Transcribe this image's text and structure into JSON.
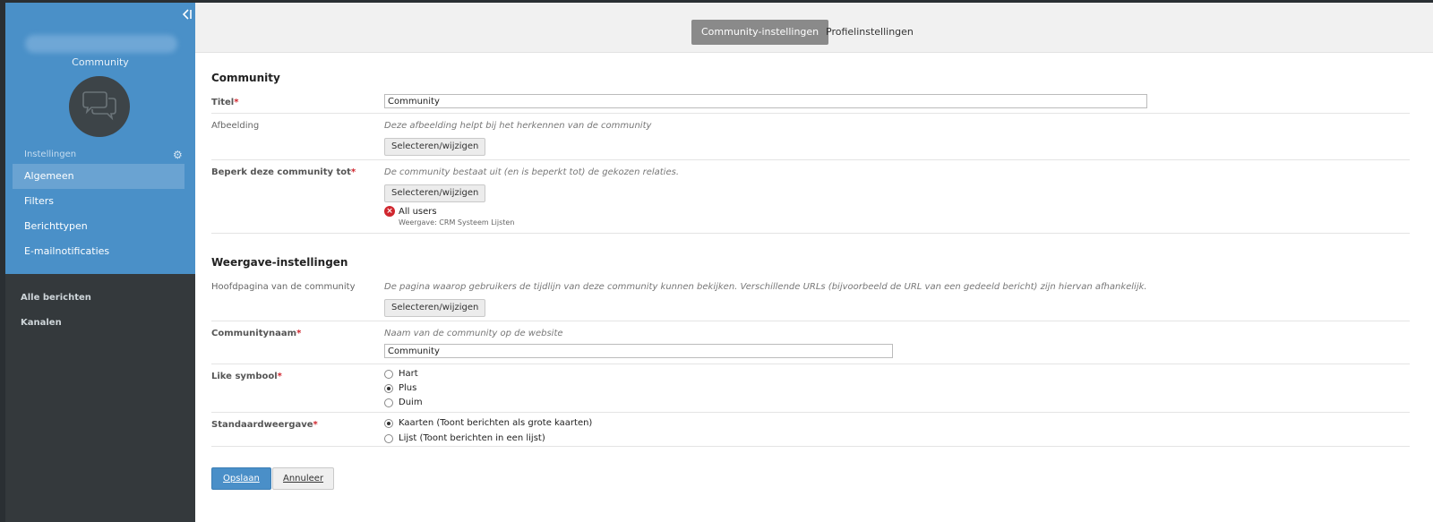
{
  "sidebar": {
    "community_label": "Community",
    "settings_heading": "Instellingen",
    "items": [
      {
        "label": "Algemeen"
      },
      {
        "label": "Filters"
      },
      {
        "label": "Berichttypen"
      },
      {
        "label": "E-mailnotificaties"
      }
    ],
    "bottom_items": [
      {
        "label": "Alle berichten"
      },
      {
        "label": "Kanalen"
      }
    ]
  },
  "tabs": [
    {
      "label": "Community-instellingen"
    },
    {
      "label": "Profielinstellingen"
    }
  ],
  "community_section": {
    "heading": "Community",
    "title_label": "Titel",
    "title_value": "Community",
    "image_label": "Afbeelding",
    "image_hint": "Deze afbeelding helpt bij het herkennen van de community",
    "image_button": "Selecteren/wijzigen",
    "restrict_label": "Beperk deze community tot",
    "restrict_hint": "De community bestaat uit (en is beperkt tot) de gekozen relaties.",
    "restrict_button": "Selecteren/wijzigen",
    "restrict_item": "All users",
    "restrict_item_sub": "Weergave: CRM Systeem Lijsten"
  },
  "display_section": {
    "heading": "Weergave-instellingen",
    "homepage_label": "Hoofdpagina van de community",
    "homepage_hint": "De pagina waarop gebruikers de tijdlijn van deze community kunnen bekijken. Verschillende URLs (bijvoorbeeld de URL van een gedeeld bericht) zijn hiervan afhankelijk.",
    "homepage_button": "Selecteren/wijzigen",
    "name_label": "Communitynaam",
    "name_hint": "Naam van de community op de website",
    "name_value": "Community",
    "like_label": "Like symbool",
    "like_options": [
      "Hart",
      "Plus",
      "Duim"
    ],
    "like_selected": "Plus",
    "view_label": "Standaardweergave",
    "view_options": [
      "Kaarten (Toont berichten als grote kaarten)",
      "Lijst (Toont berichten in een lijst)"
    ],
    "view_selected": "Kaarten (Toont berichten als grote kaarten)"
  },
  "actions": {
    "save": "Opslaan",
    "cancel": "Annuleer"
  },
  "required_marker": "*",
  "colors": {
    "sidebar_blue": "#4a90c8",
    "sidebar_dark": "#34393c",
    "primary": "#4a8fc8",
    "required": "#d0262e"
  }
}
